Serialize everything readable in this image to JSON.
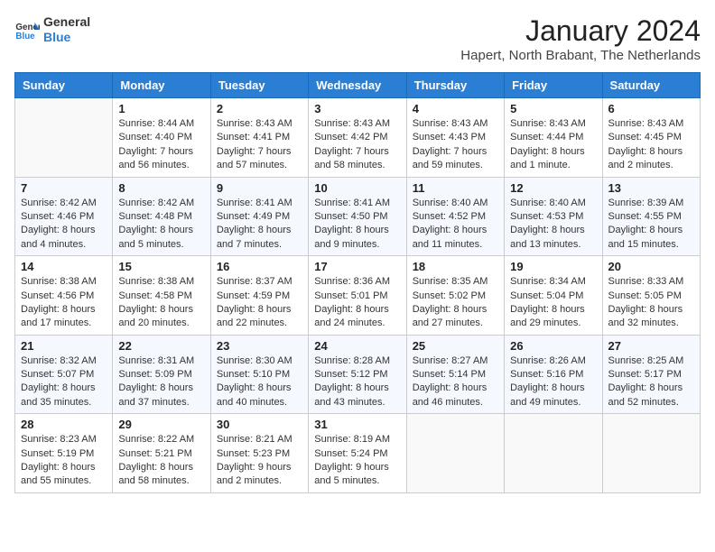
{
  "header": {
    "logo_line1": "General",
    "logo_line2": "Blue",
    "title": "January 2024",
    "subtitle": "Hapert, North Brabant, The Netherlands"
  },
  "weekdays": [
    "Sunday",
    "Monday",
    "Tuesday",
    "Wednesday",
    "Thursday",
    "Friday",
    "Saturday"
  ],
  "weeks": [
    [
      {
        "day": "",
        "sunrise": "",
        "sunset": "",
        "daylight": ""
      },
      {
        "day": "1",
        "sunrise": "Sunrise: 8:44 AM",
        "sunset": "Sunset: 4:40 PM",
        "daylight": "Daylight: 7 hours and 56 minutes."
      },
      {
        "day": "2",
        "sunrise": "Sunrise: 8:43 AM",
        "sunset": "Sunset: 4:41 PM",
        "daylight": "Daylight: 7 hours and 57 minutes."
      },
      {
        "day": "3",
        "sunrise": "Sunrise: 8:43 AM",
        "sunset": "Sunset: 4:42 PM",
        "daylight": "Daylight: 7 hours and 58 minutes."
      },
      {
        "day": "4",
        "sunrise": "Sunrise: 8:43 AM",
        "sunset": "Sunset: 4:43 PM",
        "daylight": "Daylight: 7 hours and 59 minutes."
      },
      {
        "day": "5",
        "sunrise": "Sunrise: 8:43 AM",
        "sunset": "Sunset: 4:44 PM",
        "daylight": "Daylight: 8 hours and 1 minute."
      },
      {
        "day": "6",
        "sunrise": "Sunrise: 8:43 AM",
        "sunset": "Sunset: 4:45 PM",
        "daylight": "Daylight: 8 hours and 2 minutes."
      }
    ],
    [
      {
        "day": "7",
        "sunrise": "Sunrise: 8:42 AM",
        "sunset": "Sunset: 4:46 PM",
        "daylight": "Daylight: 8 hours and 4 minutes."
      },
      {
        "day": "8",
        "sunrise": "Sunrise: 8:42 AM",
        "sunset": "Sunset: 4:48 PM",
        "daylight": "Daylight: 8 hours and 5 minutes."
      },
      {
        "day": "9",
        "sunrise": "Sunrise: 8:41 AM",
        "sunset": "Sunset: 4:49 PM",
        "daylight": "Daylight: 8 hours and 7 minutes."
      },
      {
        "day": "10",
        "sunrise": "Sunrise: 8:41 AM",
        "sunset": "Sunset: 4:50 PM",
        "daylight": "Daylight: 8 hours and 9 minutes."
      },
      {
        "day": "11",
        "sunrise": "Sunrise: 8:40 AM",
        "sunset": "Sunset: 4:52 PM",
        "daylight": "Daylight: 8 hours and 11 minutes."
      },
      {
        "day": "12",
        "sunrise": "Sunrise: 8:40 AM",
        "sunset": "Sunset: 4:53 PM",
        "daylight": "Daylight: 8 hours and 13 minutes."
      },
      {
        "day": "13",
        "sunrise": "Sunrise: 8:39 AM",
        "sunset": "Sunset: 4:55 PM",
        "daylight": "Daylight: 8 hours and 15 minutes."
      }
    ],
    [
      {
        "day": "14",
        "sunrise": "Sunrise: 8:38 AM",
        "sunset": "Sunset: 4:56 PM",
        "daylight": "Daylight: 8 hours and 17 minutes."
      },
      {
        "day": "15",
        "sunrise": "Sunrise: 8:38 AM",
        "sunset": "Sunset: 4:58 PM",
        "daylight": "Daylight: 8 hours and 20 minutes."
      },
      {
        "day": "16",
        "sunrise": "Sunrise: 8:37 AM",
        "sunset": "Sunset: 4:59 PM",
        "daylight": "Daylight: 8 hours and 22 minutes."
      },
      {
        "day": "17",
        "sunrise": "Sunrise: 8:36 AM",
        "sunset": "Sunset: 5:01 PM",
        "daylight": "Daylight: 8 hours and 24 minutes."
      },
      {
        "day": "18",
        "sunrise": "Sunrise: 8:35 AM",
        "sunset": "Sunset: 5:02 PM",
        "daylight": "Daylight: 8 hours and 27 minutes."
      },
      {
        "day": "19",
        "sunrise": "Sunrise: 8:34 AM",
        "sunset": "Sunset: 5:04 PM",
        "daylight": "Daylight: 8 hours and 29 minutes."
      },
      {
        "day": "20",
        "sunrise": "Sunrise: 8:33 AM",
        "sunset": "Sunset: 5:05 PM",
        "daylight": "Daylight: 8 hours and 32 minutes."
      }
    ],
    [
      {
        "day": "21",
        "sunrise": "Sunrise: 8:32 AM",
        "sunset": "Sunset: 5:07 PM",
        "daylight": "Daylight: 8 hours and 35 minutes."
      },
      {
        "day": "22",
        "sunrise": "Sunrise: 8:31 AM",
        "sunset": "Sunset: 5:09 PM",
        "daylight": "Daylight: 8 hours and 37 minutes."
      },
      {
        "day": "23",
        "sunrise": "Sunrise: 8:30 AM",
        "sunset": "Sunset: 5:10 PM",
        "daylight": "Daylight: 8 hours and 40 minutes."
      },
      {
        "day": "24",
        "sunrise": "Sunrise: 8:28 AM",
        "sunset": "Sunset: 5:12 PM",
        "daylight": "Daylight: 8 hours and 43 minutes."
      },
      {
        "day": "25",
        "sunrise": "Sunrise: 8:27 AM",
        "sunset": "Sunset: 5:14 PM",
        "daylight": "Daylight: 8 hours and 46 minutes."
      },
      {
        "day": "26",
        "sunrise": "Sunrise: 8:26 AM",
        "sunset": "Sunset: 5:16 PM",
        "daylight": "Daylight: 8 hours and 49 minutes."
      },
      {
        "day": "27",
        "sunrise": "Sunrise: 8:25 AM",
        "sunset": "Sunset: 5:17 PM",
        "daylight": "Daylight: 8 hours and 52 minutes."
      }
    ],
    [
      {
        "day": "28",
        "sunrise": "Sunrise: 8:23 AM",
        "sunset": "Sunset: 5:19 PM",
        "daylight": "Daylight: 8 hours and 55 minutes."
      },
      {
        "day": "29",
        "sunrise": "Sunrise: 8:22 AM",
        "sunset": "Sunset: 5:21 PM",
        "daylight": "Daylight: 8 hours and 58 minutes."
      },
      {
        "day": "30",
        "sunrise": "Sunrise: 8:21 AM",
        "sunset": "Sunset: 5:23 PM",
        "daylight": "Daylight: 9 hours and 2 minutes."
      },
      {
        "day": "31",
        "sunrise": "Sunrise: 8:19 AM",
        "sunset": "Sunset: 5:24 PM",
        "daylight": "Daylight: 9 hours and 5 minutes."
      },
      {
        "day": "",
        "sunrise": "",
        "sunset": "",
        "daylight": ""
      },
      {
        "day": "",
        "sunrise": "",
        "sunset": "",
        "daylight": ""
      },
      {
        "day": "",
        "sunrise": "",
        "sunset": "",
        "daylight": ""
      }
    ]
  ]
}
